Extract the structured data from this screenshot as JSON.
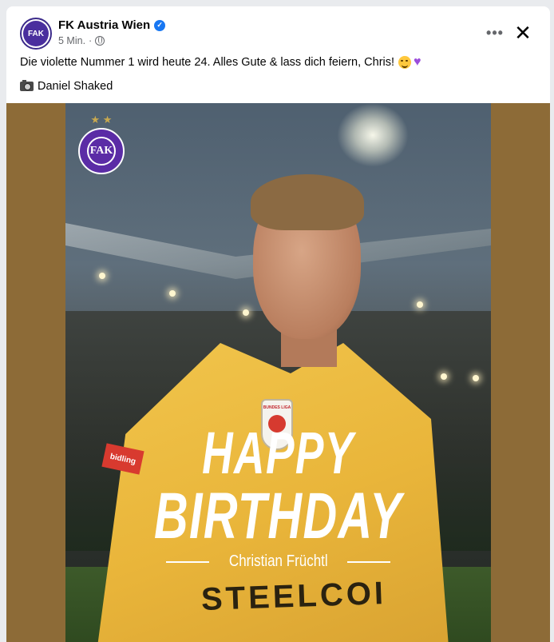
{
  "post": {
    "page_name": "FK Austria Wien",
    "verified_icon": "verified-badge-icon",
    "time": "5 Min.",
    "separator": "·",
    "audience_icon": "globe-icon",
    "more_label": "•••",
    "close_label": "✕",
    "text": "Die violette Nummer 1 wird heute 24. Alles Gute & lass dich feiern, Chris!",
    "emojis": [
      "partying-face-emoji",
      "purple-heart-emoji"
    ],
    "credit": "Daniel Shaked"
  },
  "image": {
    "background_color": "#8d6b37",
    "headline_line1": "HAPPY",
    "headline_line2": "BIRTHDAY",
    "player_name": "Christian Früchtl",
    "shirt_sponsor": "STEELCOI",
    "sleeve_sponsor": "bidling",
    "crest_letters": "FAK",
    "badge_text": "BUNDES LIGA"
  },
  "colors": {
    "verified": "#1877f2",
    "club_purple": "#5b2ca6",
    "jersey_yellow": "#f1c54c"
  }
}
